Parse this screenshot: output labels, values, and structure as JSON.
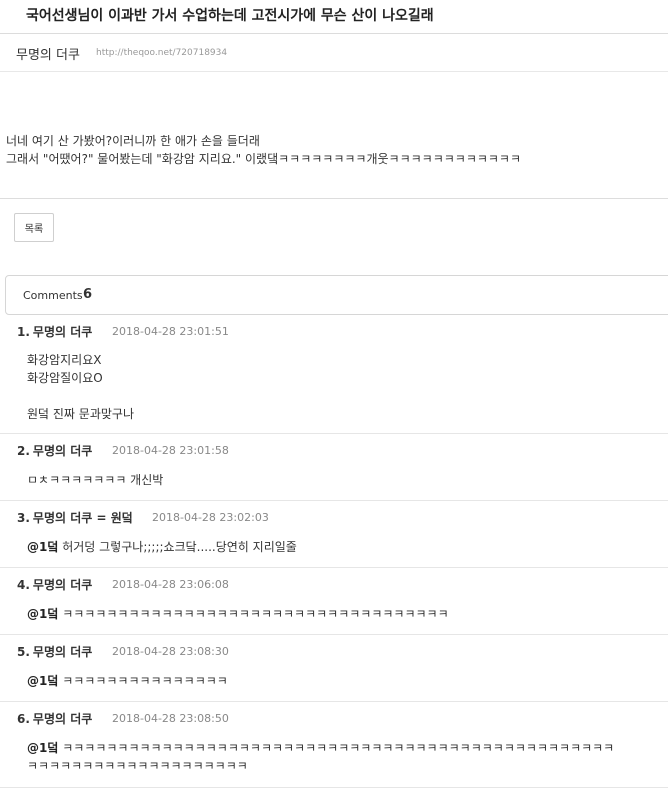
{
  "post": {
    "title": "국어선생님이 이과반 가서 수업하는데 고전시가에 무슨 산이 나오길래",
    "author": "무명의 더쿠",
    "url": "http://theqoo.net/720718934",
    "content_lines": [
      "너네 여기 산 가봤어?이러니까 한 애가 손을 들더래",
      "그래서 \"어땠어?\" 물어봤는데 \"화강암 지리요.\" 이랬댘ㅋㅋㅋㅋㅋㅋㅋㅋ개웃ㅋㅋㅋㅋㅋㅋㅋㅋㅋㅋㅋㅋ"
    ],
    "list_button": "목록"
  },
  "comments_section": {
    "label": "Comments",
    "count": "6"
  },
  "comments": [
    {
      "number": "1.",
      "author": "무명의 더쿠",
      "time": "2018-04-28 23:01:51",
      "lines": [
        "화강암지리요X",
        "화강암질이요O",
        "",
        "원덬 진짜 문과맞구나"
      ]
    },
    {
      "number": "2.",
      "author": "무명의 더쿠",
      "time": "2018-04-28 23:01:58",
      "lines": [
        "ㅁㅊㅋㅋㅋㅋㅋㅋㅋ 개신박"
      ]
    },
    {
      "number": "3.",
      "author": "무명의 더쿠 = 원덬",
      "time": "2018-04-28 23:02:03",
      "ref": "@1덬",
      "lines": [
        "허거덩 그렇구나;;;;;쇼크닼.....당연히 지리일줄"
      ]
    },
    {
      "number": "4.",
      "author": "무명의 더쿠",
      "time": "2018-04-28 23:06:08",
      "ref": "@1덬",
      "lines": [
        "ㅋㅋㅋㅋㅋㅋㅋㅋㅋㅋㅋㅋㅋㅋㅋㅋㅋㅋㅋㅋㅋㅋㅋㅋㅋㅋㅋㅋㅋㅋㅋㅋㅋㅋㅋ"
      ]
    },
    {
      "number": "5.",
      "author": "무명의 더쿠",
      "time": "2018-04-28 23:08:30",
      "ref": "@1덬",
      "lines": [
        "ㅋㅋㅋㅋㅋㅋㅋㅋㅋㅋㅋㅋㅋㅋㅋ"
      ]
    },
    {
      "number": "6.",
      "author": "무명의 더쿠",
      "time": "2018-04-28 23:08:50",
      "ref": "@1덬",
      "lines": [
        "ㅋㅋㅋㅋㅋㅋㅋㅋㅋㅋㅋㅋㅋㅋㅋㅋㅋㅋㅋㅋㅋㅋㅋㅋㅋㅋㅋㅋㅋㅋㅋㅋㅋㅋㅋㅋㅋㅋㅋㅋㅋㅋㅋㅋㅋㅋㅋㅋㅋㅋ",
        "ㅋㅋㅋㅋㅋㅋㅋㅋㅋㅋㅋㅋㅋㅋㅋㅋㅋㅋㅋㅋ"
      ]
    }
  ]
}
